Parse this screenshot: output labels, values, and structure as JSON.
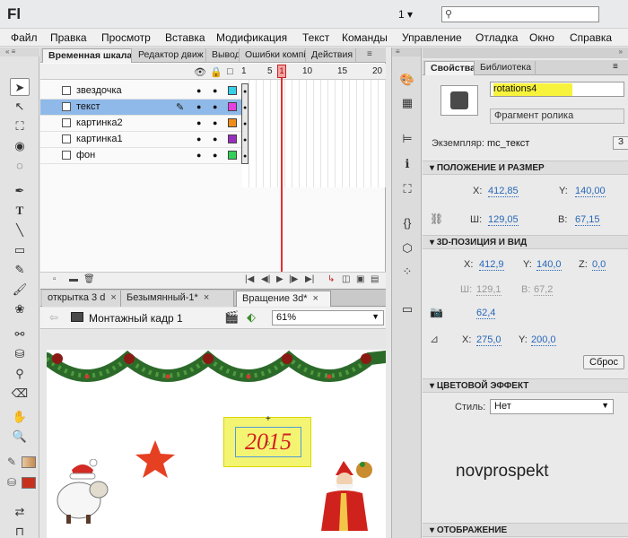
{
  "app": {
    "logo": "Fl",
    "workspace": "1",
    "workspace_arrow": "▾",
    "search_placeholder": ""
  },
  "menu": [
    "Файл",
    "Правка",
    "Просмотр",
    "Вставка",
    "Модификация",
    "Текст",
    "Команды",
    "Управление",
    "Отладка",
    "Окно",
    "Справка"
  ],
  "timeline": {
    "tabs": [
      "Временная шкала",
      "Редактор движ",
      "Вывод",
      "Ошибки компі",
      "Действия"
    ],
    "ruler": [
      "1",
      "5",
      "10",
      "15",
      "20"
    ],
    "layers": [
      {
        "name": "звездочка",
        "color": "#33d0e8",
        "selected": false
      },
      {
        "name": "текст",
        "color": "#e83fe0",
        "selected": true
      },
      {
        "name": "картинка2",
        "color": "#f08c18",
        "selected": false
      },
      {
        "name": "картинка1",
        "color": "#9a2fbf",
        "selected": false
      },
      {
        "name": "фон",
        "color": "#33d058",
        "selected": false
      }
    ]
  },
  "doc_tabs": [
    {
      "label": "открытка 3 d",
      "close": "×",
      "active": false
    },
    {
      "label": "Безымянный-1*",
      "close": "×",
      "active": false
    },
    {
      "label": "Вращение 3d*",
      "close": "×",
      "active": true
    }
  ],
  "stage": {
    "scene": "Монтажный кадр 1",
    "zoom": "61%",
    "text": "2015",
    "watermark": "novprospekt"
  },
  "props": {
    "tabs": [
      "Свойства",
      "Библиотека"
    ],
    "instance_name": "rotations4",
    "symbol_type": "Фрагмент ролика",
    "instance_label": "Экземпляр:",
    "instance_value": "mc_текст",
    "swap": "З",
    "sections": {
      "position": "ПОЛОЖЕНИЕ И РАЗМЕР",
      "pos3d": "3D-ПОЗИЦИЯ И ВИД",
      "color": "ЦВЕТОВОЙ ЭФФЕКТ",
      "display": "ОТОБРАЖЕНИЕ"
    },
    "x": "412,85",
    "y": "140,00",
    "w": "129,05",
    "h": "67,15",
    "x3d": "412,9",
    "y3d": "140,0",
    "z3d": "0,0",
    "w3d": "129,1",
    "h3d": "67,2",
    "perspective": "62,4",
    "vx": "275,0",
    "vy": "200,0",
    "reset": "Сброс",
    "style_label": "Стиль:",
    "style_value": "Нет",
    "labels": {
      "x": "X:",
      "y": "Y:",
      "w": "Ш:",
      "h": "В:",
      "z": "Z:"
    }
  }
}
